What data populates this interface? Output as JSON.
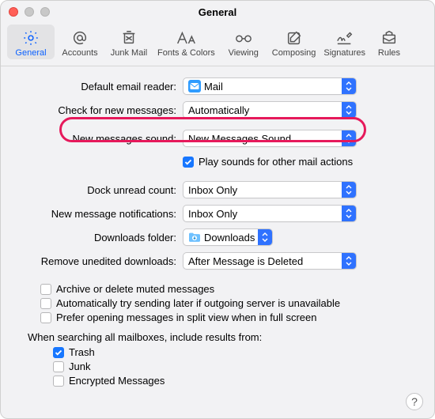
{
  "window": {
    "title": "General"
  },
  "toolbar": {
    "items": [
      {
        "label": "General"
      },
      {
        "label": "Accounts"
      },
      {
        "label": "Junk Mail"
      },
      {
        "label": "Fonts & Colors"
      },
      {
        "label": "Viewing"
      },
      {
        "label": "Composing"
      },
      {
        "label": "Signatures"
      },
      {
        "label": "Rules"
      }
    ]
  },
  "labels": {
    "default_reader": "Default email reader:",
    "check_new": "Check for new messages:",
    "new_sound": "New messages sound:",
    "play_other": "Play sounds for other mail actions",
    "dock_unread": "Dock unread count:",
    "notifications": "New message notifications:",
    "downloads": "Downloads folder:",
    "remove_unedited": "Remove unedited downloads:",
    "archive_muted": "Archive or delete muted messages",
    "auto_retry": "Automatically try sending later if outgoing server is unavailable",
    "split_view": "Prefer opening messages in split view when in full screen",
    "search_header": "When searching all mailboxes, include results from:",
    "trash": "Trash",
    "junk": "Junk",
    "encrypted": "Encrypted Messages"
  },
  "values": {
    "default_reader": "Mail",
    "check_new": "Automatically",
    "new_sound": "New Messages Sound",
    "dock_unread": "Inbox Only",
    "notifications": "Inbox Only",
    "downloads": "Downloads",
    "remove_unedited": "After Message is Deleted",
    "play_other_checked": true,
    "archive_muted_checked": false,
    "auto_retry_checked": false,
    "split_view_checked": false,
    "trash_checked": true,
    "junk_checked": false,
    "encrypted_checked": false
  },
  "help": "?"
}
